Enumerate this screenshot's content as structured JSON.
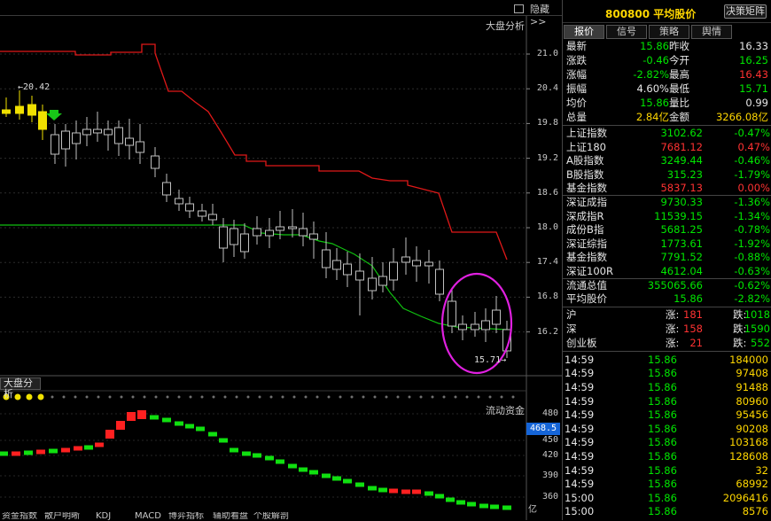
{
  "top": {
    "hide_label": "隐藏>>",
    "panel_label": "大盘分析"
  },
  "price_axis": [
    "21.0",
    "20.4",
    "19.8",
    "19.2",
    "18.6",
    "18.0",
    "17.4",
    "16.8",
    "16.2"
  ],
  "annotations": {
    "high_label": "←20.42",
    "low_label": "15.71→"
  },
  "sub_panel": {
    "tab_label": "大盘分析",
    "title": "流动资金",
    "value_box": "468.5",
    "unit": "亿",
    "axis": [
      "480",
      "450",
      "420",
      "390",
      "360"
    ]
  },
  "bottom_tabs": [
    "资金指数",
    "散户明晰",
    "KDJ",
    "MACD",
    "博弈指标",
    "辅助看盘",
    "个股解剖"
  ],
  "quote": {
    "code_name": "800800 平均股价",
    "decision_btn": "决策矩阵",
    "tabs": [
      "报价",
      "信号",
      "策略",
      "舆情"
    ],
    "stats": [
      {
        "l1": "最新",
        "v1": "15.86",
        "c1": "green",
        "l2": "昨收",
        "v2": "16.33",
        "c2": "white"
      },
      {
        "l1": "涨跌",
        "v1": "-0.46",
        "c1": "green",
        "l2": "今开",
        "v2": "16.25",
        "c2": "green"
      },
      {
        "l1": "涨幅",
        "v1": "-2.82%",
        "c1": "green",
        "l2": "最高",
        "v2": "16.43",
        "c2": "red"
      },
      {
        "l1": "振幅",
        "v1": "4.60%",
        "c1": "white",
        "l2": "最低",
        "v2": "15.71",
        "c2": "green"
      },
      {
        "l1": "均价",
        "v1": "15.86",
        "c1": "green",
        "l2": "量比",
        "v2": "0.99",
        "c2": "white"
      },
      {
        "l1": "总量",
        "v1": "2.84亿",
        "c1": "yellow",
        "l2": "金额",
        "v2": "3266.08亿",
        "c2": "yellow"
      }
    ],
    "indices": [
      {
        "name": "上证指数",
        "value": "3102.62",
        "change": "-0.47%",
        "color": "green"
      },
      {
        "name": "上证180",
        "value": "7681.12",
        "change": "0.47%",
        "color": "red"
      },
      {
        "name": "A股指数",
        "value": "3249.44",
        "change": "-0.46%",
        "color": "green"
      },
      {
        "name": "B股指数",
        "value": "315.23",
        "change": "-1.79%",
        "color": "green"
      },
      {
        "name": "基金指数",
        "value": "5837.13",
        "change": "0.00%",
        "color": "red"
      },
      {
        "name": "深证成指",
        "value": "9730.33",
        "change": "-1.36%",
        "color": "green"
      },
      {
        "name": "深成指R",
        "value": "11539.15",
        "change": "-1.34%",
        "color": "green"
      },
      {
        "name": "成份B指",
        "value": "5681.25",
        "change": "-0.78%",
        "color": "green"
      },
      {
        "name": "深证综指",
        "value": "1773.61",
        "change": "-1.92%",
        "color": "green"
      },
      {
        "name": "基金指数",
        "value": "7791.52",
        "change": "-0.88%",
        "color": "green"
      },
      {
        "name": "深证100R",
        "value": "4612.04",
        "change": "-0.63%",
        "color": "green"
      },
      {
        "name": "流通总值",
        "value": "355065.66",
        "change": "-0.62%",
        "color": "green"
      },
      {
        "name": "平均股价",
        "value": "15.86",
        "change": "-2.82%",
        "color": "green"
      }
    ],
    "breadth": [
      {
        "name": "沪",
        "up_label": "涨:",
        "up": "181",
        "down_label": "跌:",
        "down": "1018"
      },
      {
        "name": "深",
        "up_label": "涨:",
        "up": "158",
        "down_label": "跌:",
        "down": "1590"
      },
      {
        "name": "创业板",
        "up_label": "涨:",
        "up": "21",
        "down_label": "跌:",
        "down": "552"
      }
    ],
    "ticks": [
      {
        "time": "14:59",
        "price": "15.86",
        "vol": "184000"
      },
      {
        "time": "14:59",
        "price": "15.86",
        "vol": "97408"
      },
      {
        "time": "14:59",
        "price": "15.86",
        "vol": "91488"
      },
      {
        "time": "14:59",
        "price": "15.86",
        "vol": "80960"
      },
      {
        "time": "14:59",
        "price": "15.86",
        "vol": "95456"
      },
      {
        "time": "14:59",
        "price": "15.86",
        "vol": "90208"
      },
      {
        "time": "14:59",
        "price": "15.86",
        "vol": "103168"
      },
      {
        "time": "14:59",
        "price": "15.86",
        "vol": "128608"
      },
      {
        "time": "14:59",
        "price": "15.86",
        "vol": "32"
      },
      {
        "time": "14:59",
        "price": "15.86",
        "vol": "68992"
      },
      {
        "time": "15:00",
        "price": "15.86",
        "vol": "2096416"
      },
      {
        "time": "15:00",
        "price": "15.86",
        "vol": "8576"
      }
    ]
  },
  "colors": {
    "up": "#ff3232",
    "down": "#00e600",
    "accent": "#ffd700",
    "highlight_circle": "#e020e0"
  }
}
